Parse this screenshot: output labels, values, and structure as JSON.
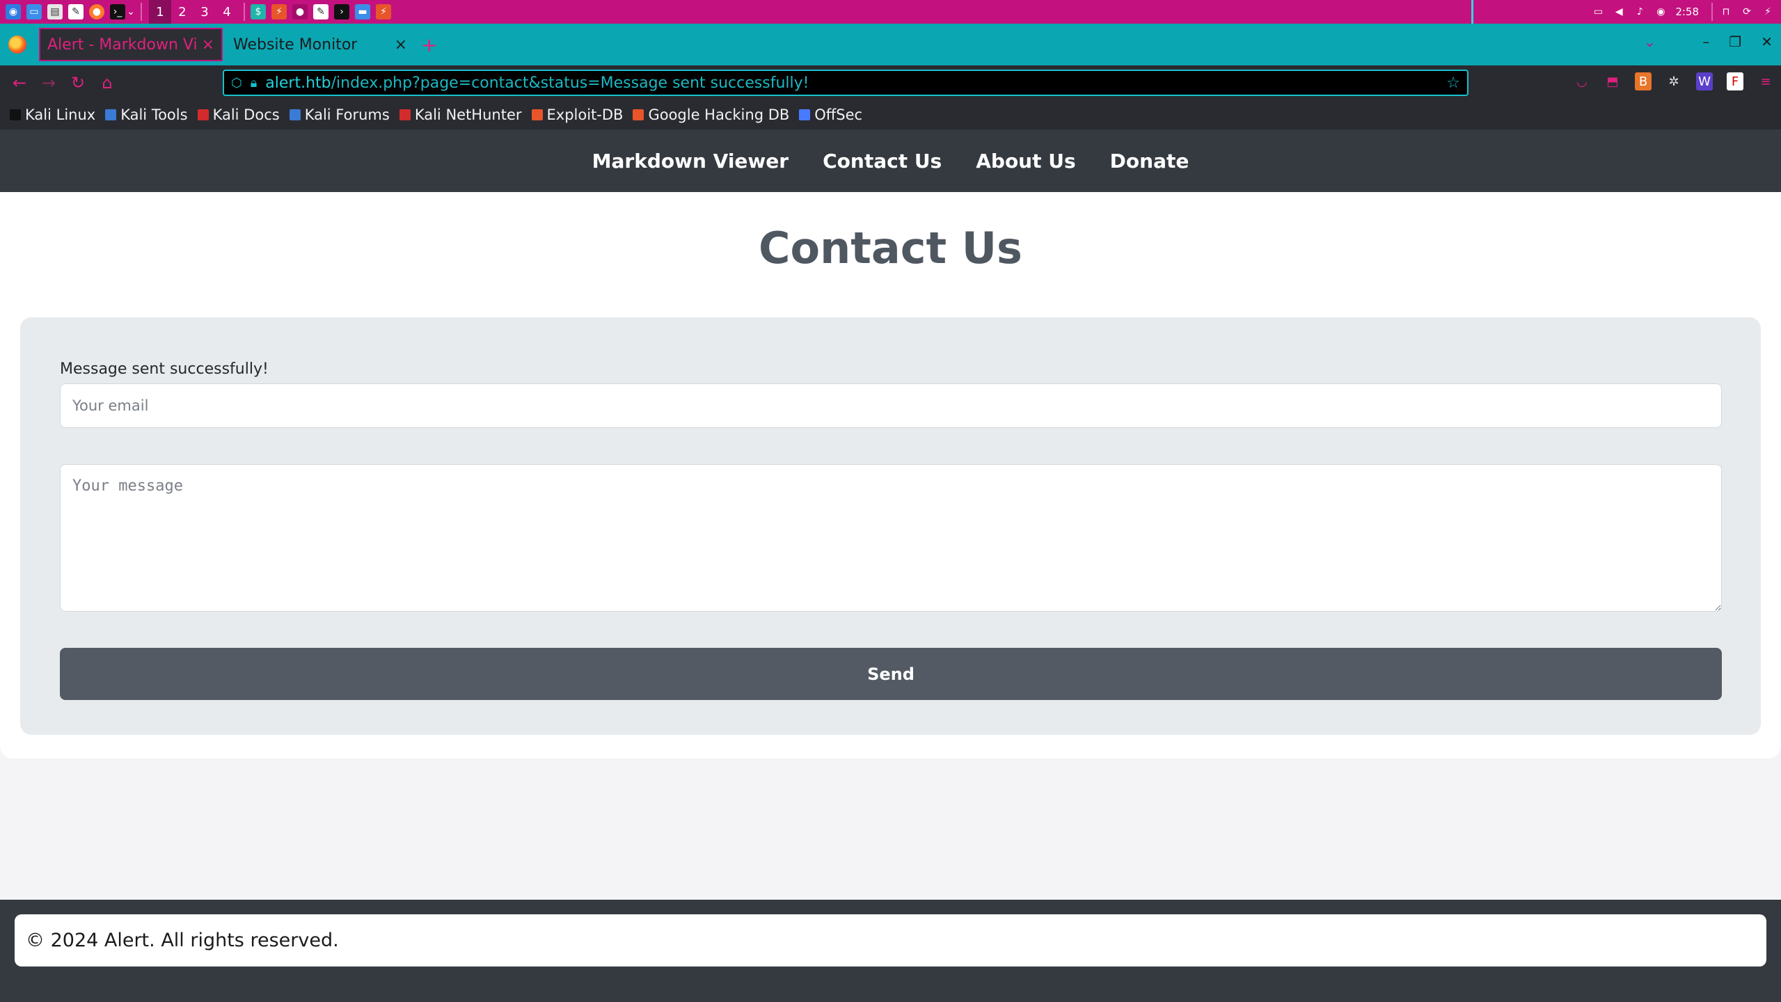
{
  "taskbar": {
    "workspaces": [
      "1",
      "2",
      "3",
      "4"
    ],
    "clock": "2:58"
  },
  "browser": {
    "tabs": [
      {
        "label": "Alert - Markdown Viewer",
        "close": "×"
      },
      {
        "label": "Website Monitor",
        "close": "×"
      }
    ],
    "new_tab": "+",
    "url_host": "alert.htb",
    "url_path": "/index.php?page=contact&status=Message sent successfully!",
    "bookmarks": [
      "Kali Linux",
      "Kali Tools",
      "Kali Docs",
      "Kali Forums",
      "Kali NetHunter",
      "Exploit-DB",
      "Google Hacking DB",
      "OffSec"
    ],
    "bookmark_colors": [
      "#1a1a1a",
      "#3a7bd5",
      "#d22b2b",
      "#3a7bd5",
      "#d22b2b",
      "#e8552a",
      "#e8552a",
      "#4a7bff"
    ]
  },
  "site_nav": {
    "items": [
      "Markdown Viewer",
      "Contact Us",
      "About Us",
      "Donate"
    ]
  },
  "contact": {
    "title": "Contact Us",
    "status_message": "Message sent successfully!",
    "email_placeholder": "Your email",
    "message_placeholder": "Your message",
    "send_label": "Send"
  },
  "footer": {
    "text": "© 2024 Alert. All rights reserved."
  },
  "colors": {
    "taskbar": "#c3127f",
    "tabbar": "#0aa7b2",
    "toolbar": "#2a2b31",
    "site_nav": "#343a40",
    "button": "#535a63"
  }
}
